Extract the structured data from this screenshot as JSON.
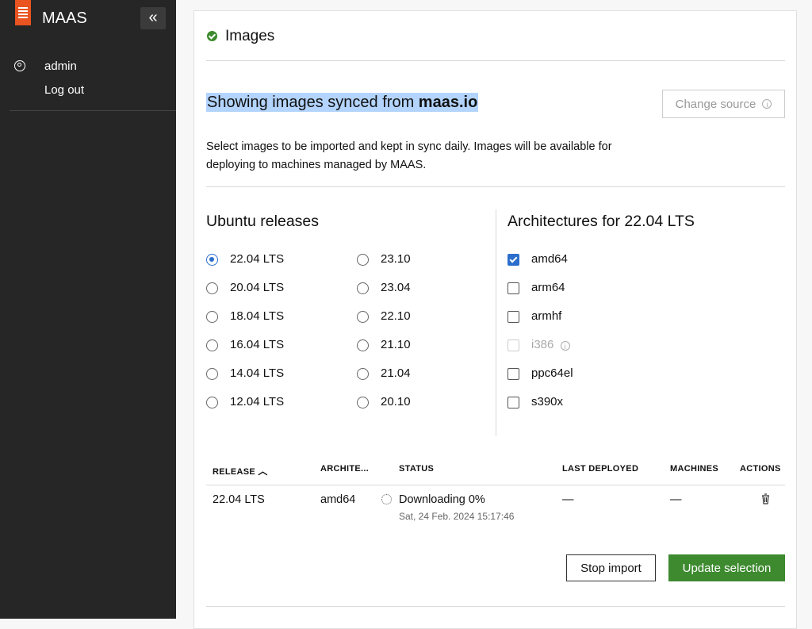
{
  "sidebar": {
    "app_title": "MAAS",
    "collapse_glyph": "«",
    "user_label": "admin",
    "logout_label": "Log out"
  },
  "main": {
    "heading": "Images",
    "synced_prefix": "Showing images synced from ",
    "synced_source": "maas.io",
    "change_source_label": "Change source",
    "description": "Select images to be imported and kept in sync daily. Images will be available for deploying to machines managed by MAAS.",
    "ubuntu_title": "Ubuntu releases",
    "releases": [
      {
        "label": "22.04 LTS",
        "selected": true
      },
      {
        "label": "20.04 LTS"
      },
      {
        "label": "18.04 LTS"
      },
      {
        "label": "16.04 LTS"
      },
      {
        "label": "14.04 LTS"
      },
      {
        "label": "12.04 LTS"
      },
      {
        "label": "23.10"
      },
      {
        "label": "23.04"
      },
      {
        "label": "22.10"
      },
      {
        "label": "21.10"
      },
      {
        "label": "21.04"
      },
      {
        "label": "20.10"
      }
    ],
    "arch_title": "Architectures for 22.04 LTS",
    "architectures": [
      {
        "label": "amd64",
        "checked": true
      },
      {
        "label": "arm64"
      },
      {
        "label": "armhf"
      },
      {
        "label": "i386",
        "disabled": true
      },
      {
        "label": "ppc64el"
      },
      {
        "label": "s390x"
      }
    ],
    "table": {
      "headers": [
        "RELEASE",
        "ARCHITE...",
        "STATUS",
        "LAST DEPLOYED",
        "MACHINES",
        "ACTIONS"
      ],
      "rows": [
        {
          "release": "22.04 LTS",
          "arch": "amd64",
          "status": "Downloading 0%",
          "status_time": "Sat, 24 Feb. 2024 15:17:46",
          "last_deployed": "—",
          "machines": "—"
        }
      ]
    },
    "stop_import_label": "Stop import",
    "update_selection_label": "Update selection"
  },
  "colors": {
    "brand": "#e95420",
    "primary": "#2c6ecb",
    "positive": "#3d8a2f",
    "sidebar_bg": "#262626"
  }
}
